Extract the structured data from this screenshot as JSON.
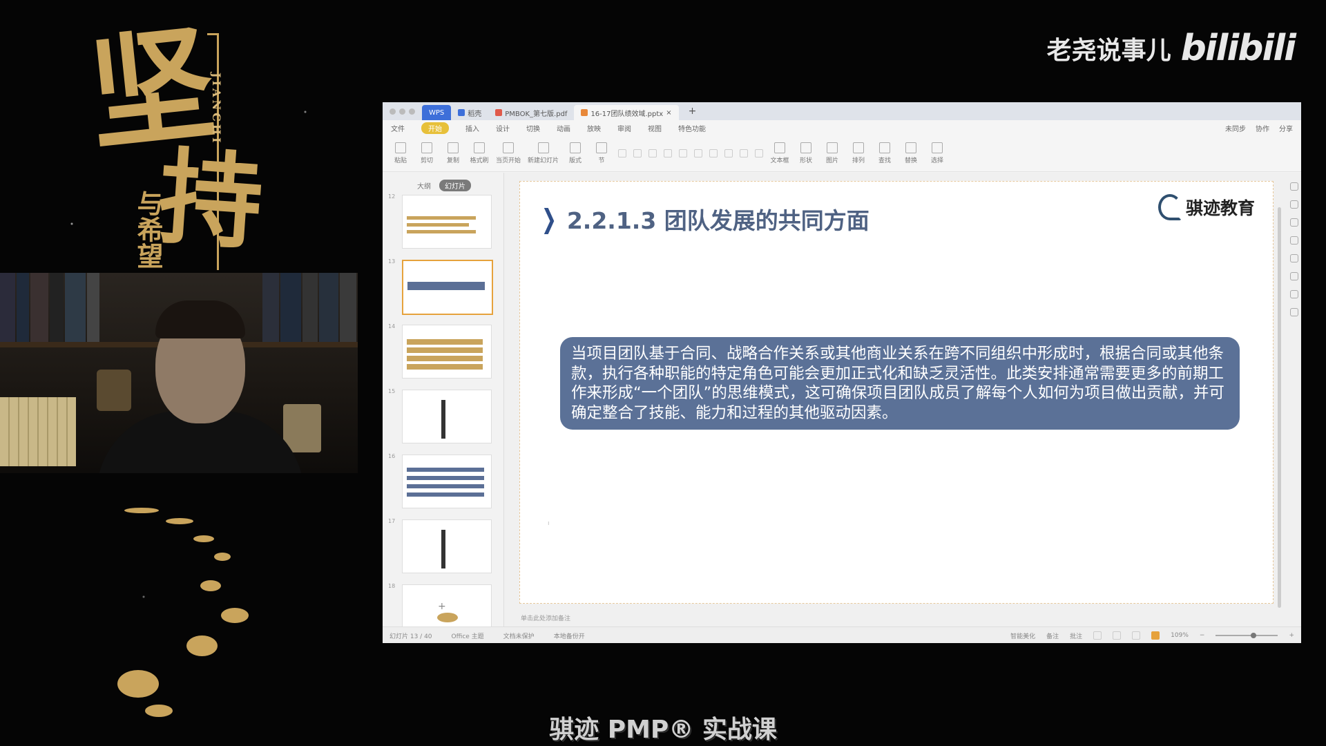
{
  "overlay": {
    "calligraphy_main_1": "坚",
    "calligraphy_main_2": "持",
    "calligraphy_small": "与希望",
    "calligraphy_latin": "JIANCHI",
    "brand_text": "老尧说事儿",
    "brand_logo": "bilibili",
    "caption": "骐迹 PMP® 实战课"
  },
  "wps": {
    "tabs": [
      {
        "label": "WPS",
        "icon": "wps-logo-icon"
      },
      {
        "label": "稻壳",
        "icon": "docer-icon"
      },
      {
        "label": "PMBOK_第七版.pdf",
        "icon": "pdf-icon",
        "color": "#e05a4a"
      },
      {
        "label": "16-17团队绩效域.pptx",
        "icon": "ppt-icon",
        "color": "#e8883a"
      }
    ],
    "menu": [
      "文件",
      "开始",
      "插入",
      "设计",
      "切换",
      "动画",
      "放映",
      "审阅",
      "视图",
      "特色功能"
    ],
    "menu_active": "开始",
    "menu_right": [
      "未同步",
      "协作",
      "分享"
    ],
    "ribbon": [
      "粘贴",
      "剪切",
      "复制",
      "格式刷",
      "当页开始",
      "新建幻灯片",
      "版式",
      "节",
      "文本框",
      "形状",
      "图片",
      "排列",
      "查找",
      "替换",
      "选择"
    ],
    "sidebar_tabs": [
      "大纲",
      "幻灯片"
    ],
    "sidebar_active": "幻灯片",
    "slide_numbers": [
      "12",
      "13",
      "14",
      "15",
      "16",
      "17",
      "18"
    ],
    "selected_slide": "13",
    "slide": {
      "title": "2.2.1.3 团队发展的共同方面",
      "logo_text": "骐迹教育",
      "body": "当项目团队基于合同、战略合作关系或其他商业关系在跨不同组织中形成时，根据合同或其他条款，执行各种职能的特定角色可能会更加正式化和缺乏灵活性。此类安排通常需要更多的前期工作来形成“一个团队”的思维模式，这可确保项目团队成员了解每个人如何为项目做出贡献，并可确定整合了技能、能力和过程的其他驱动因素。"
    },
    "notes_placeholder": "单击此处添加备注",
    "status": {
      "slide_count": "幻灯片 13 / 40",
      "theme": "Office 主题",
      "protect": "文档未保护",
      "backup": "本地备份开",
      "beautify": "智能美化",
      "notes": "备注",
      "comment": "批注",
      "zoom": "109%",
      "zoom_fraction": 0.61
    }
  }
}
